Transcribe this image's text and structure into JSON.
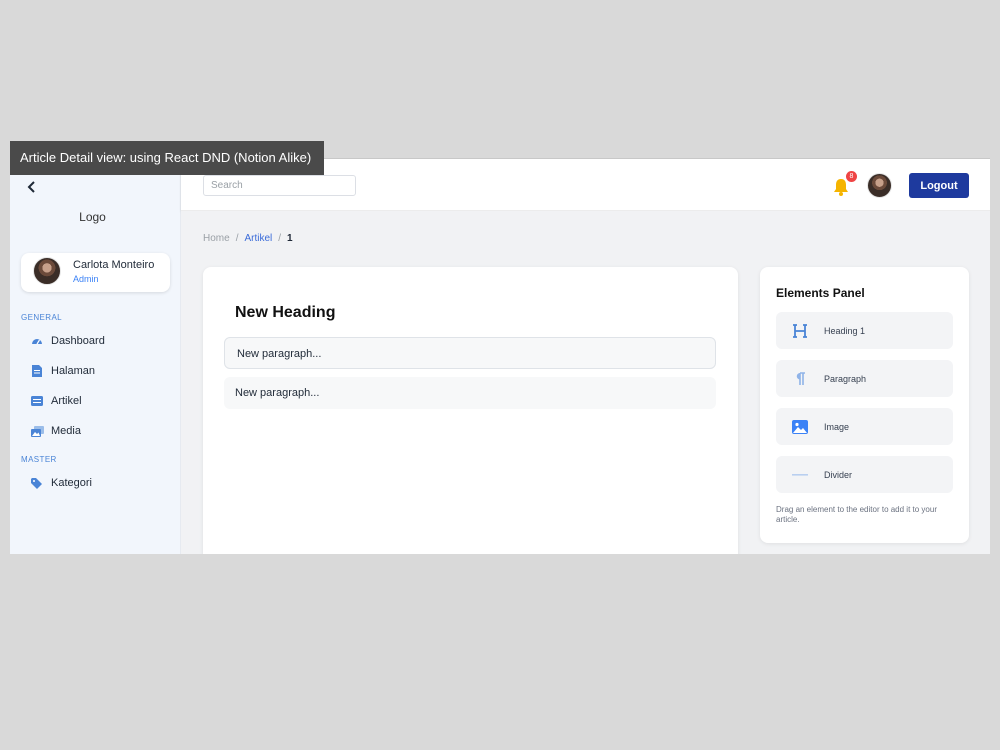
{
  "caption": "Article Detail view: using React DND (Notion Alike)",
  "sidebar": {
    "logo": "Logo",
    "user": {
      "name": "Carlota Monteiro",
      "role": "Admin"
    },
    "sections": [
      {
        "label": "GENERAL",
        "items": [
          {
            "label": "Dashboard",
            "icon": "dashboard-icon"
          },
          {
            "label": "Halaman",
            "icon": "page-icon"
          },
          {
            "label": "Artikel",
            "icon": "article-icon"
          },
          {
            "label": "Media",
            "icon": "media-icon"
          }
        ]
      },
      {
        "label": "MASTER",
        "items": [
          {
            "label": "Kategori",
            "icon": "tag-icon"
          }
        ]
      }
    ]
  },
  "topbar": {
    "search_placeholder": "Search",
    "notification_count": "8",
    "logout_label": "Logout"
  },
  "breadcrumb": {
    "home": "Home",
    "section": "Artikel",
    "current": "1",
    "separator": "/"
  },
  "editor": {
    "heading": "New Heading",
    "paragraphs": [
      "New paragraph...",
      "New paragraph..."
    ]
  },
  "elements_panel": {
    "title": "Elements Panel",
    "items": [
      {
        "label": "Heading 1",
        "icon": "heading-icon"
      },
      {
        "label": "Paragraph",
        "icon": "paragraph-icon"
      },
      {
        "label": "Image",
        "icon": "image-icon"
      },
      {
        "label": "Divider",
        "icon": "divider-icon"
      }
    ],
    "hint": "Drag an element to the editor to add it to your article."
  },
  "colors": {
    "accent": "#1e3a9e",
    "link": "#3b6cd9",
    "sidebar_bg": "#f2f6fc",
    "badge": "#ef4444",
    "icon_blue": "#4a84d6"
  }
}
